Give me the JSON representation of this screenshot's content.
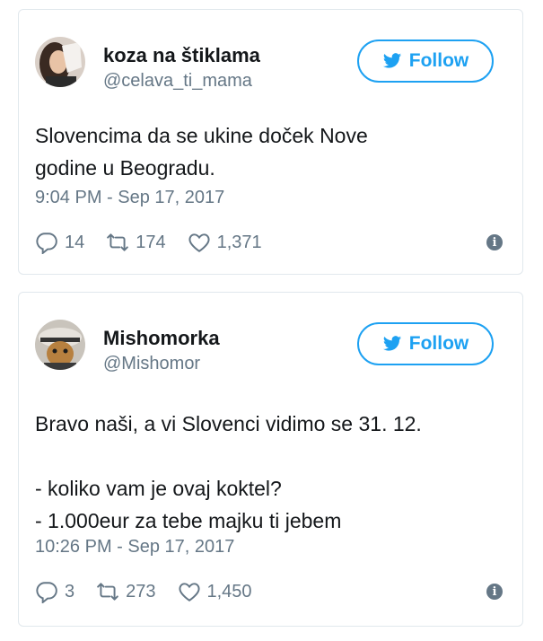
{
  "tweets": [
    {
      "name": "koza na štiklama",
      "handle": "@celava_ti_mama",
      "follow_label": "Follow",
      "text_lines": [
        "Slovencima da se ukine doček Nove",
        "godine u Beogradu."
      ],
      "timestamp": "9:04 PM - Sep 17, 2017",
      "replies": "14",
      "retweets": "174",
      "likes": "1,371"
    },
    {
      "name": "Mishomorka",
      "handle": "@Mishomor",
      "follow_label": "Follow",
      "text_lines": [
        "Bravo naši, a vi Slovenci vidimo se 31. 12.",
        "",
        "- koliko vam je ovaj koktel?",
        "- 1.000eur za tebe majku ti jebem"
      ],
      "timestamp": "10:26 PM - Sep 17, 2017",
      "replies": "3",
      "retweets": "273",
      "likes": "1,450"
    }
  ],
  "colors": {
    "accent": "#1da1f2",
    "muted": "#657786",
    "text": "#14171a",
    "border": "#e1e8ed"
  },
  "icons": [
    "bird-icon",
    "reply-icon",
    "retweet-icon",
    "heart-icon",
    "info-icon"
  ]
}
